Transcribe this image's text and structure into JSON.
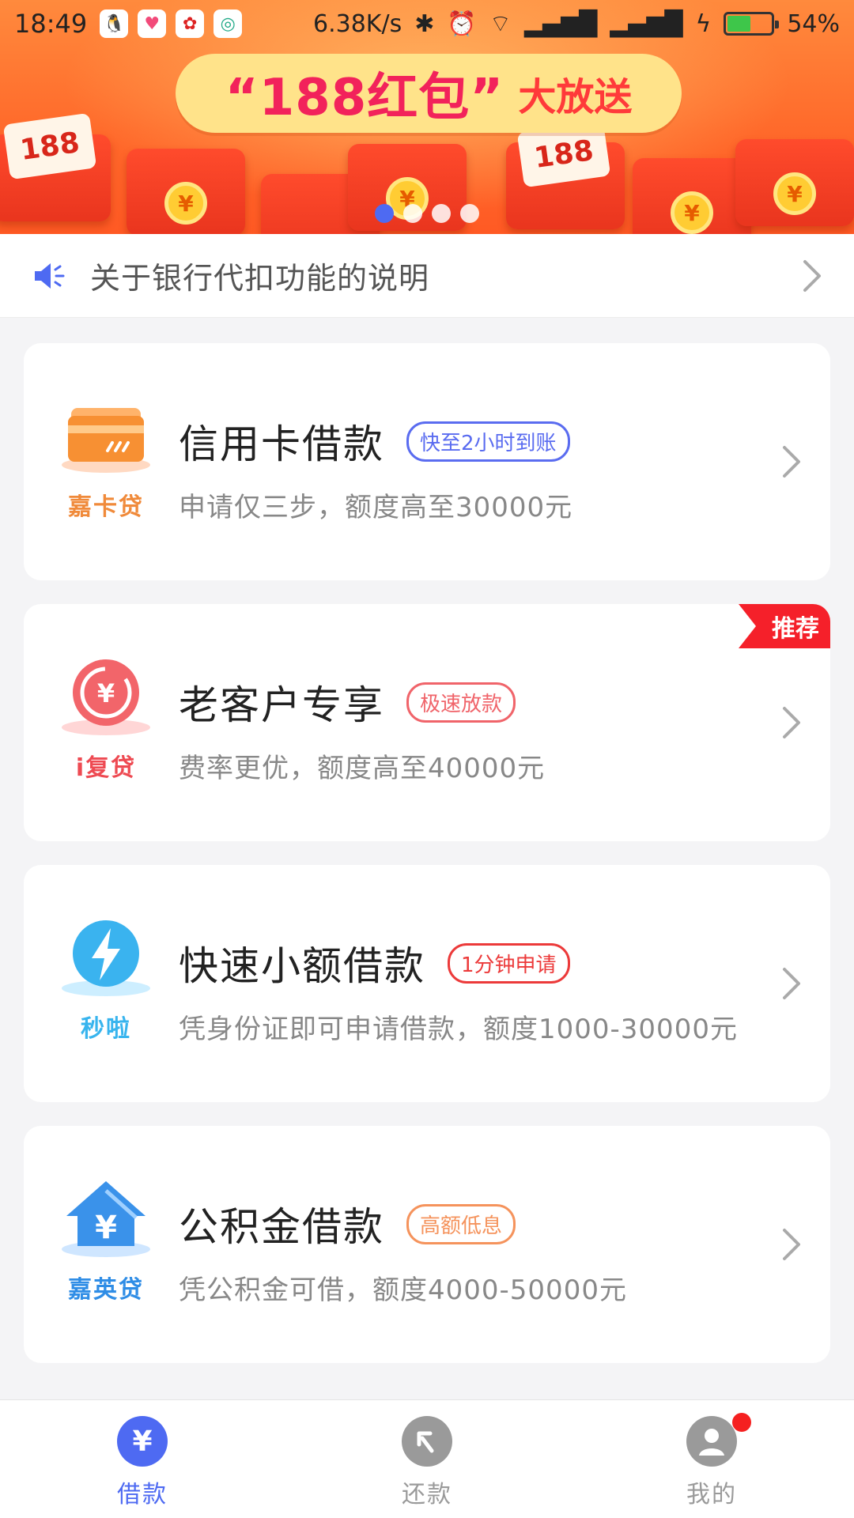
{
  "status_bar": {
    "time": "18:49",
    "speed": "6.38K/s",
    "battery": "54%",
    "battery_level": 0.54
  },
  "banner": {
    "headline_main": "“188红包”",
    "headline_sub": "大放送",
    "envelope_label": "188",
    "slide_count": 4,
    "active_slide": 1
  },
  "notice": {
    "text": "关于银行代扣功能的说明"
  },
  "loans": [
    {
      "brand": "嘉卡贷",
      "title": "信用卡借款",
      "badge": "快至2小时到账",
      "desc": "申请仅三步，额度高至30000元",
      "badge_color": "#5a6cf0",
      "brand_color": "#f08a3a"
    },
    {
      "brand": "i复贷",
      "title": "老客户专享",
      "badge": "极速放款",
      "desc": "费率更优，额度高至40000元",
      "badge_color": "#f0646a",
      "brand_color": "#ee4a52",
      "tag": "推荐"
    },
    {
      "brand": "秒啦",
      "title": "快速小额借款",
      "badge": "1分钟申请",
      "desc": "凭身份证即可申请借款，额度1000-30000元",
      "badge_color": "#ec3a3a",
      "brand_color": "#37b4ee"
    },
    {
      "brand": "嘉英贷",
      "title": "公积金借款",
      "badge": "高额低息",
      "desc": "凭公积金可借，额度4000-50000元",
      "badge_color": "#f5935c",
      "brand_color": "#2f8de6"
    }
  ],
  "tabs": [
    {
      "label": "借款",
      "active": true
    },
    {
      "label": "还款",
      "active": false
    },
    {
      "label": "我的",
      "active": false,
      "has_notification": true
    }
  ],
  "colors": {
    "accent": "#4e6af2",
    "inactive_tab": "#9a9a9a"
  }
}
